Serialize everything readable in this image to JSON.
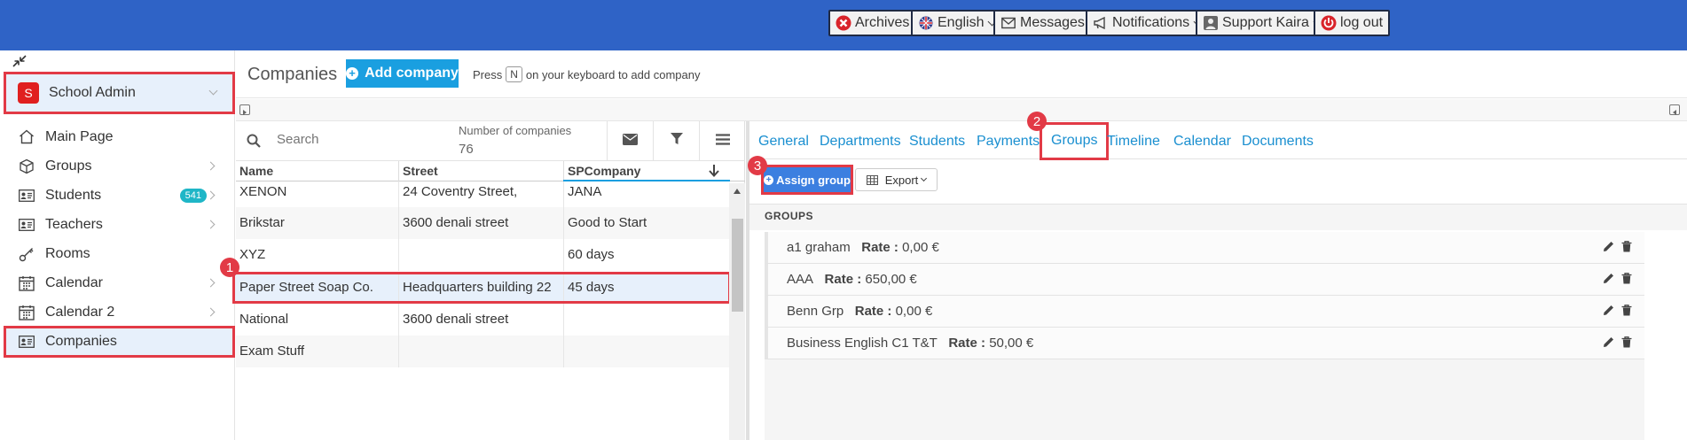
{
  "topbar": {
    "archives": "Archives",
    "language": "English",
    "messages": "Messages",
    "notifications": "Notifications",
    "user": "Support Kaira",
    "logout": "log out"
  },
  "sidebar": {
    "school": {
      "initial": "S",
      "name": "School Admin"
    },
    "items": [
      {
        "label": "Main Page",
        "icon": "home-icon"
      },
      {
        "label": "Groups",
        "icon": "box-icon"
      },
      {
        "label": "Students",
        "icon": "id-card-icon",
        "count": "541"
      },
      {
        "label": "Teachers",
        "icon": "id-card-icon"
      },
      {
        "label": "Rooms",
        "icon": "key-icon"
      },
      {
        "label": "Calendar",
        "icon": "calendar-icon"
      },
      {
        "label": "Calendar 2",
        "icon": "calendar-icon"
      },
      {
        "label": "Companies",
        "icon": "id-card-icon"
      }
    ]
  },
  "header": {
    "title": "Companies",
    "add_label": "Add company",
    "hint_before": "Press",
    "hint_key": "N",
    "hint_after": "on your keyboard to add company"
  },
  "list": {
    "search_placeholder": "Search",
    "count_label": "Number of companies",
    "count_value": "76",
    "columns": [
      "Name",
      "Street",
      "SPCompany"
    ],
    "rows": [
      [
        "XENON",
        "24 Coventry Street,",
        "JANA"
      ],
      [
        "Brikstar",
        "3600 denali street",
        "Good to Start"
      ],
      [
        "XYZ",
        "",
        "60 days"
      ],
      [
        "Paper Street Soap Co.",
        "Headquarters building 22",
        "45 days"
      ],
      [
        "National",
        "3600 denali street",
        ""
      ],
      [
        "Exam Stuff",
        "",
        ""
      ]
    ]
  },
  "detail": {
    "tabs": [
      "General",
      "Departments",
      "Students",
      "Payments",
      "Groups",
      "Timeline",
      "Calendar",
      "Documents"
    ],
    "assign_label": "Assign group",
    "export_label": "Export",
    "groups_header": "GROUPS",
    "rate_label": "Rate :",
    "groups": [
      {
        "name": "a1 graham",
        "rate": "0,00 €"
      },
      {
        "name": "AAA",
        "rate": "650,00 €"
      },
      {
        "name": "Benn Grp",
        "rate": "0,00 €"
      },
      {
        "name": "Business English C1 T&T",
        "rate": "50,00 €"
      }
    ]
  },
  "markers": [
    "1",
    "2",
    "3"
  ],
  "colors": {
    "topbar": "#2f63c6",
    "accent": "#1a9fe0",
    "highlight": "#e23a46"
  }
}
